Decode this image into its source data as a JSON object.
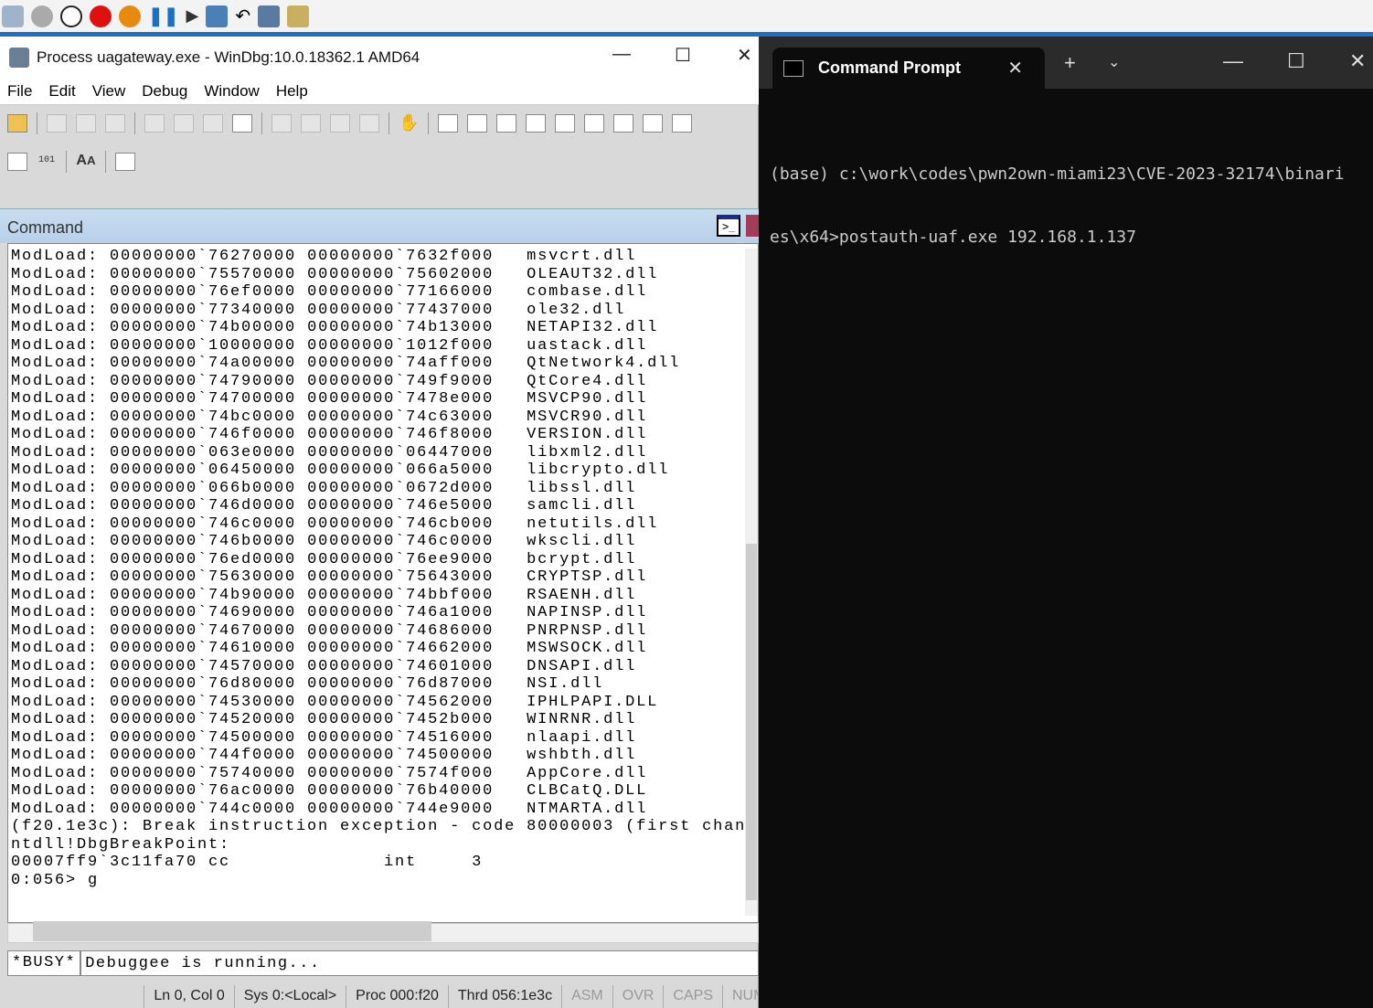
{
  "windbg": {
    "title": "Process uagateway.exe - WinDbg:10.0.18362.1 AMD64",
    "menu": [
      "File",
      "Edit",
      "View",
      "Debug",
      "Window",
      "Help"
    ],
    "pane_title": "Command",
    "modloads": [
      [
        "00000000`76270000",
        "00000000`7632f000",
        "msvcrt.dll"
      ],
      [
        "00000000`75570000",
        "00000000`75602000",
        "OLEAUT32.dll"
      ],
      [
        "00000000`76ef0000",
        "00000000`77166000",
        "combase.dll"
      ],
      [
        "00000000`77340000",
        "00000000`77437000",
        "ole32.dll"
      ],
      [
        "00000000`74b00000",
        "00000000`74b13000",
        "NETAPI32.dll"
      ],
      [
        "00000000`10000000",
        "00000000`1012f000",
        "uastack.dll"
      ],
      [
        "00000000`74a00000",
        "00000000`74aff000",
        "QtNetwork4.dll"
      ],
      [
        "00000000`74790000",
        "00000000`749f9000",
        "QtCore4.dll"
      ],
      [
        "00000000`74700000",
        "00000000`7478e000",
        "MSVCP90.dll"
      ],
      [
        "00000000`74bc0000",
        "00000000`74c63000",
        "MSVCR90.dll"
      ],
      [
        "00000000`746f0000",
        "00000000`746f8000",
        "VERSION.dll"
      ],
      [
        "00000000`063e0000",
        "00000000`06447000",
        "libxml2.dll"
      ],
      [
        "00000000`06450000",
        "00000000`066a5000",
        "libcrypto.dll"
      ],
      [
        "00000000`066b0000",
        "00000000`0672d000",
        "libssl.dll"
      ],
      [
        "00000000`746d0000",
        "00000000`746e5000",
        "samcli.dll"
      ],
      [
        "00000000`746c0000",
        "00000000`746cb000",
        "netutils.dll"
      ],
      [
        "00000000`746b0000",
        "00000000`746c0000",
        "wkscli.dll"
      ],
      [
        "00000000`76ed0000",
        "00000000`76ee9000",
        "bcrypt.dll"
      ],
      [
        "00000000`75630000",
        "00000000`75643000",
        "CRYPTSP.dll"
      ],
      [
        "00000000`74b90000",
        "00000000`74bbf000",
        "RSAENH.dll"
      ],
      [
        "00000000`74690000",
        "00000000`746a1000",
        "NAPINSP.dll"
      ],
      [
        "00000000`74670000",
        "00000000`74686000",
        "PNRPNSP.dll"
      ],
      [
        "00000000`74610000",
        "00000000`74662000",
        "MSWSOCK.dll"
      ],
      [
        "00000000`74570000",
        "00000000`74601000",
        "DNSAPI.dll"
      ],
      [
        "00000000`76d80000",
        "00000000`76d87000",
        "NSI.dll"
      ],
      [
        "00000000`74530000",
        "00000000`74562000",
        "IPHLPAPI.DLL"
      ],
      [
        "00000000`74520000",
        "00000000`7452b000",
        "WINRNR.dll"
      ],
      [
        "00000000`74500000",
        "00000000`74516000",
        "nlaapi.dll"
      ],
      [
        "00000000`744f0000",
        "00000000`74500000",
        "wshbth.dll"
      ],
      [
        "00000000`75740000",
        "00000000`7574f000",
        "AppCore.dll"
      ],
      [
        "00000000`76ac0000",
        "00000000`76b40000",
        "CLBCatQ.DLL"
      ],
      [
        "00000000`744c0000",
        "00000000`744e9000",
        "NTMARTA.dll"
      ]
    ],
    "modload_label": "ModLoad:",
    "tail_lines": [
      "(f20.1e3c): Break instruction exception - code 80000003 (first chan",
      "ntdll!DbgBreakPoint:",
      "00007ff9`3c11fa70 cc              int     3",
      "0:056> g"
    ],
    "busy": "*BUSY*",
    "input_value": "Debuggee is running...",
    "status": [
      "Ln 0, Col 0",
      "Sys 0:<Local>",
      "Proc 000:f20",
      "Thrd 056:1e3c",
      "ASM",
      "OVR",
      "CAPS",
      "NUM"
    ]
  },
  "terminal": {
    "tab_title": "Command Prompt",
    "lines": [
      "(base) c:\\work\\codes\\pwn2own-miami23\\CVE-2023-32174\\binari",
      "es\\x64>postauth-uaf.exe 192.168.1.137"
    ]
  }
}
